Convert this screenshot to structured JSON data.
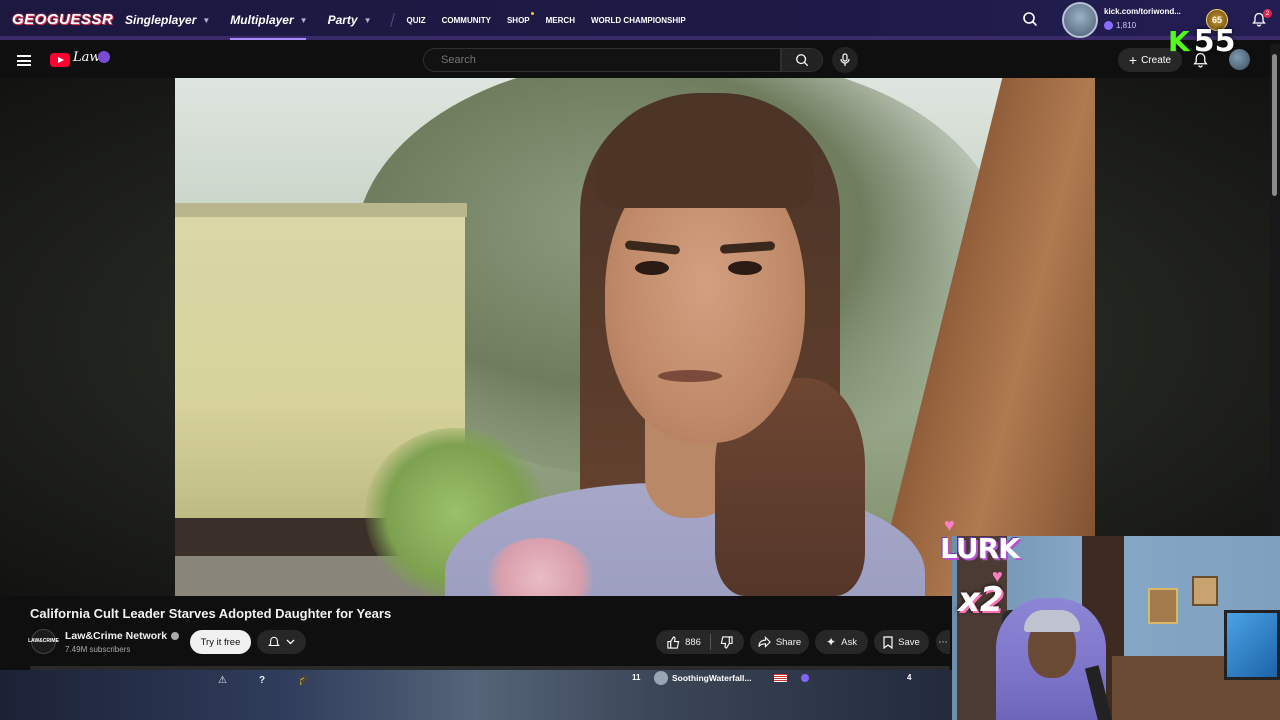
{
  "geoguessr": {
    "logo": "GEOGUESSR",
    "nav_main": [
      {
        "label": "Singleplayer",
        "active": false
      },
      {
        "label": "Multiplayer",
        "active": true
      },
      {
        "label": "Party",
        "active": false
      }
    ],
    "nav_sub": [
      "QUIZ",
      "COMMUNITY",
      "SHOP",
      "MERCH",
      "WORLD CHAMPIONSHIP"
    ],
    "username": "kick.com/toriwond...",
    "coins": "1,810",
    "level": "65",
    "notifications": "2"
  },
  "kick_overlay": {
    "letter": "K",
    "count": "55"
  },
  "youtube": {
    "search_placeholder": "Search",
    "create_label": "Create",
    "brand": "Law"
  },
  "video": {
    "title": "California Cult Leader Starves Adopted Daughter for Years",
    "channel_name": "Law&Crime Network",
    "channel_avatar_text": "LAW&CRIME",
    "subscribers": "7.49M subscribers",
    "try_label": "Try it free",
    "likes": "886",
    "share_label": "Share",
    "ask_label": "Ask",
    "save_label": "Save"
  },
  "bottom_strip": {
    "rank": "11",
    "player": "SoothingWaterfall...",
    "score": "4",
    "icons": [
      "warning-icon",
      "help-icon",
      "graduation-cap-icon"
    ]
  },
  "webcam_overlay": {
    "text1": "LURK",
    "text2": "x2"
  },
  "colors": {
    "geo_bar": "#1d1a46",
    "youtube_red": "#ff0033",
    "kick_green": "#53fc18",
    "active_underline": "#a98aff"
  }
}
